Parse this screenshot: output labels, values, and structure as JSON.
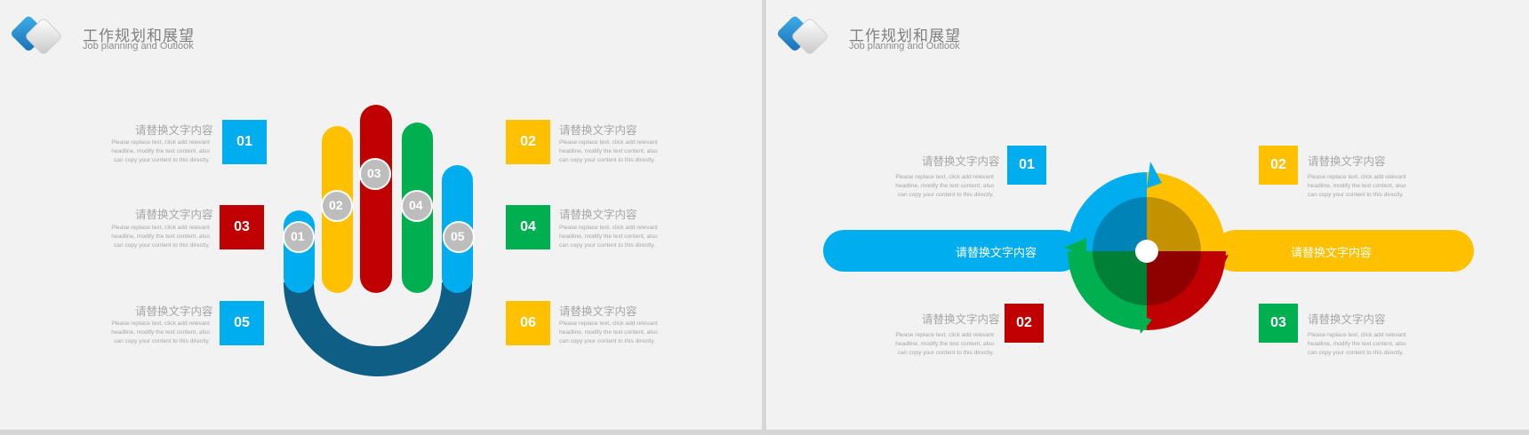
{
  "header": {
    "title_cn": "工作规划和展望",
    "title_en": "Job planning and Outlook"
  },
  "colors": {
    "blue": "#00AEEF",
    "red": "#C00000",
    "yellow": "#FFC000",
    "green": "#00B050",
    "navy": "#0E5E86",
    "gray_circle": "#BFBFBF"
  },
  "slide1": {
    "items": [
      {
        "num": "01",
        "label": "请替换文字内容",
        "desc": "Please replace text, click add relevant headline, modify the text content, also can copy your content to this directly."
      },
      {
        "num": "02",
        "label": "请替换文字内容",
        "desc": "Please replace text, click add relevant headline, modify the text content, also can copy your content to this directly."
      },
      {
        "num": "03",
        "label": "请替换文字内容",
        "desc": "Please replace text, click add relevant headline, modify the text content, also can copy your content to this directly."
      },
      {
        "num": "04",
        "label": "请替换文字内容",
        "desc": "Please replace text, click add relevant headline, modify the text content, also can copy your content to this directly."
      },
      {
        "num": "05",
        "label": "请替换文字内容",
        "desc": "Please replace text, click add relevant headline, modify the text content, also can copy your content to this directly."
      },
      {
        "num": "06",
        "label": "请替换文字内容",
        "desc": "Please replace text, click add relevant headline, modify the text content, also can copy your content to this directly."
      }
    ],
    "finger_numbers": [
      "01",
      "02",
      "03",
      "04",
      "05"
    ]
  },
  "slide2": {
    "items": [
      {
        "num": "01",
        "label": "请替换文字内容",
        "desc": "Please replace text, click add relevant headline, modify the text content, also can copy your content to this directly."
      },
      {
        "num": "02",
        "label": "请替换文字内容",
        "desc": "Please replace text, click add relevant headline, modify the text content, also can copy your content to this directly."
      },
      {
        "num": "02",
        "label": "请替换文字内容",
        "desc": "Please replace text, click add relevant headline, modify the text content, also can copy your content to this directly."
      },
      {
        "num": "03",
        "label": "请替换文字内容",
        "desc": "Please replace text, click add relevant headline, modify the text content, also can copy your content to this directly."
      }
    ],
    "left_bar_label": "请替换文字内容",
    "right_bar_label": "请替换文字内容"
  }
}
